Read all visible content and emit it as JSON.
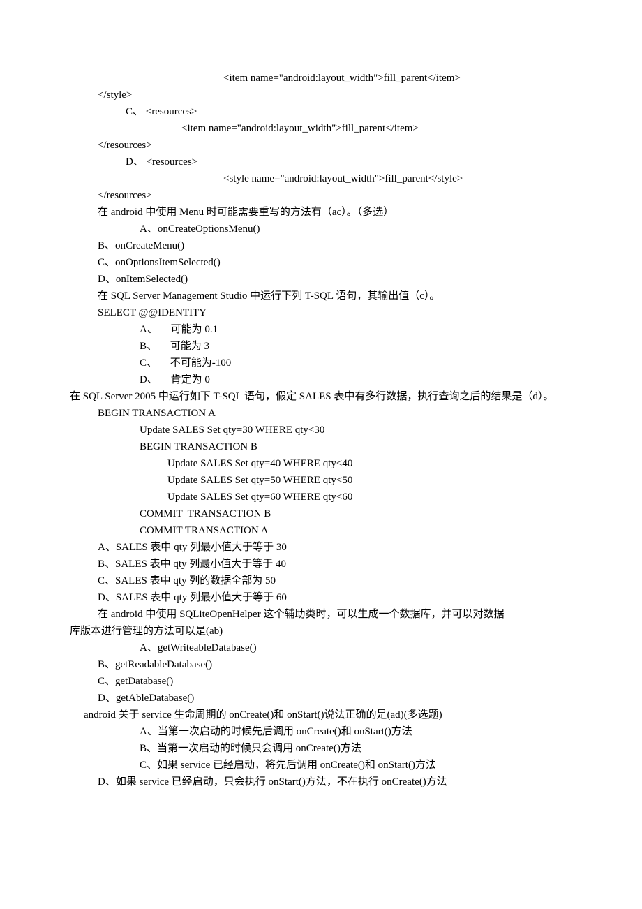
{
  "lines": [
    {
      "cls": "ind11",
      "text": "<item name=\"android:layout_width\">fill_parent</item>"
    },
    {
      "cls": "ind2",
      "text": "</style>"
    },
    {
      "cls": "ind4",
      "text": "C、 <resources>"
    },
    {
      "cls": "ind8",
      "text": "<item name=\"android:layout_width\">fill_parent</item>"
    },
    {
      "cls": "ind2",
      "text": "</resources>"
    },
    {
      "cls": "ind4",
      "text": "D、 <resources>"
    },
    {
      "cls": "ind11",
      "text": "<style name=\"android:layout_width\">fill_parent</style>"
    },
    {
      "cls": "ind2",
      "text": "</resources>"
    },
    {
      "cls": "ind2",
      "text": "在 android 中使用 Menu 时可能需要重写的方法有（ac）。（多选）"
    },
    {
      "cls": "ind5",
      "text": "A、onCreateOptionsMenu()"
    },
    {
      "cls": "ind2",
      "text": "B、onCreateMenu()"
    },
    {
      "cls": "ind2",
      "text": "C、onOptionsItemSelected()"
    },
    {
      "cls": "ind2",
      "text": "D、onItemSelected()"
    },
    {
      "cls": "ind2",
      "text": "在 SQL Server Management Studio 中运行下列 T-SQL 语句，其输出值（c）。"
    },
    {
      "cls": "ind2",
      "text": "SELECT @@IDENTITY"
    },
    {
      "cls": "ind5",
      "text": "A、     可能为 0.1"
    },
    {
      "cls": "ind5",
      "text": "B、     可能为 3"
    },
    {
      "cls": "ind5",
      "text": "C、     不可能为-100"
    },
    {
      "cls": "ind5",
      "text": "D、     肯定为 0"
    },
    {
      "cls": "ind0",
      "text": "在 SQL Server 2005 中运行如下 T-SQL 语句，假定 SALES 表中有多行数据，执行查询之后的结果是（d）。"
    },
    {
      "cls": "ind2",
      "text": "BEGIN TRANSACTION A"
    },
    {
      "cls": "ind5",
      "text": "Update SALES Set qty=30 WHERE qty<30"
    },
    {
      "cls": "ind5",
      "text": "BEGIN TRANSACTION B"
    },
    {
      "cls": "ind7",
      "text": "Update SALES Set qty=40 WHERE qty<40"
    },
    {
      "cls": "ind7",
      "text": "Update SALES Set qty=50 WHERE qty<50"
    },
    {
      "cls": "ind7",
      "text": "Update SALES Set qty=60 WHERE qty<60"
    },
    {
      "cls": "ind5",
      "text": "COMMIT  TRANSACTION B"
    },
    {
      "cls": "ind5",
      "text": "COMMIT TRANSACTION A"
    },
    {
      "cls": "ind2",
      "text": "A、SALES 表中 qty 列最小值大于等于 30"
    },
    {
      "cls": "ind2",
      "text": "B、SALES 表中 qty 列最小值大于等于 40"
    },
    {
      "cls": "ind2",
      "text": "C、SALES 表中 qty 列的数据全部为 50"
    },
    {
      "cls": "ind2",
      "text": "D、SALES 表中 qty 列最小值大于等于 60"
    },
    {
      "cls": "ind2",
      "text": "在 android 中使用 SQLiteOpenHelper 这个辅助类时，可以生成一个数据库，并可以对数据"
    },
    {
      "cls": "ind0",
      "text": "库版本进行管理的方法可以是(ab)"
    },
    {
      "cls": "ind5",
      "text": "A、getWriteableDatabase()"
    },
    {
      "cls": "ind2",
      "text": "B、getReadableDatabase()"
    },
    {
      "cls": "ind2",
      "text": "C、getDatabase()"
    },
    {
      "cls": "ind2",
      "text": "D、getAbleDatabase()"
    },
    {
      "cls": "ind1",
      "text": "android 关于 service 生命周期的 onCreate()和 onStart()说法正确的是(ad)(多选题)"
    },
    {
      "cls": "ind5",
      "text": "A、当第一次启动的时候先后调用 onCreate()和 onStart()方法"
    },
    {
      "cls": "ind5",
      "text": "B、当第一次启动的时候只会调用 onCreate()方法"
    },
    {
      "cls": "ind5",
      "text": "C、如果 service 已经启动，将先后调用 onCreate()和 onStart()方法"
    },
    {
      "cls": "ind2",
      "text": "D、如果 service 已经启动，只会执行 onStart()方法，不在执行 onCreate()方法"
    }
  ]
}
